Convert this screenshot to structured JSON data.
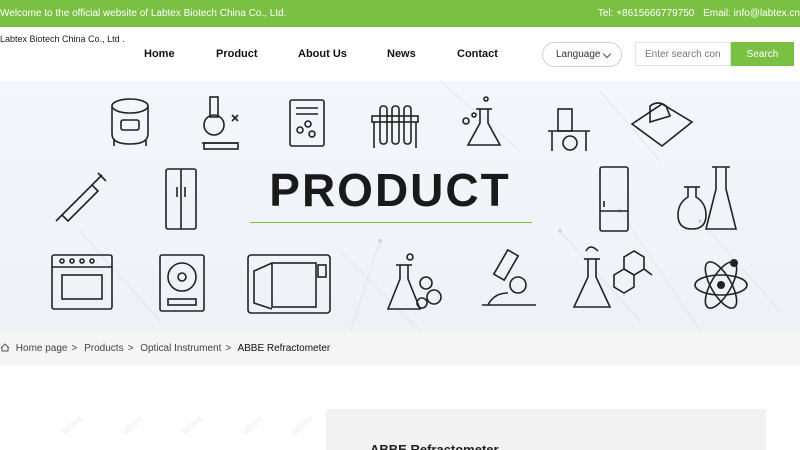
{
  "topbar": {
    "welcome": "Welcome to the official website of Labtex Biotech China Co., Ltd.",
    "tel": "Tel: +8615666779750",
    "email": "Email: info@labtex.cn"
  },
  "header": {
    "logo_text": "Labtex Biotech China Co., Ltd .",
    "nav": [
      {
        "label": "Home"
      },
      {
        "label": "Product"
      },
      {
        "label": "About Us"
      },
      {
        "label": "News"
      },
      {
        "label": "Contact"
      }
    ],
    "language_label": "Language",
    "search_placeholder": "Enter search cont",
    "search_button": "Search"
  },
  "banner": {
    "title": "PRODUCT",
    "icons": [
      "rice-cooker-icon",
      "microscope-icon",
      "book-icon",
      "test-tubes-icon",
      "flask-icon",
      "lab-bench-icon",
      "wipes-icon",
      "syringe-icon",
      "refrigerator-icon",
      "tall-fridge-icon",
      "flasks-icon",
      "oven-icon",
      "sample-incubator-icon",
      "autoclave-icon",
      "bubbling-flask-icon",
      "microscope-icon",
      "chemistry-icon",
      "atom-icon"
    ],
    "accent_color": "#7ac143"
  },
  "breadcrumb": {
    "items": [
      "Home page",
      "Products",
      "Optical Instrument",
      "ABBE Refractometer"
    ],
    "separator": ">"
  },
  "product": {
    "title": "ABBE Refractometer"
  },
  "theme": {
    "brand_green": "#7ac143",
    "text_dark": "#111111"
  }
}
